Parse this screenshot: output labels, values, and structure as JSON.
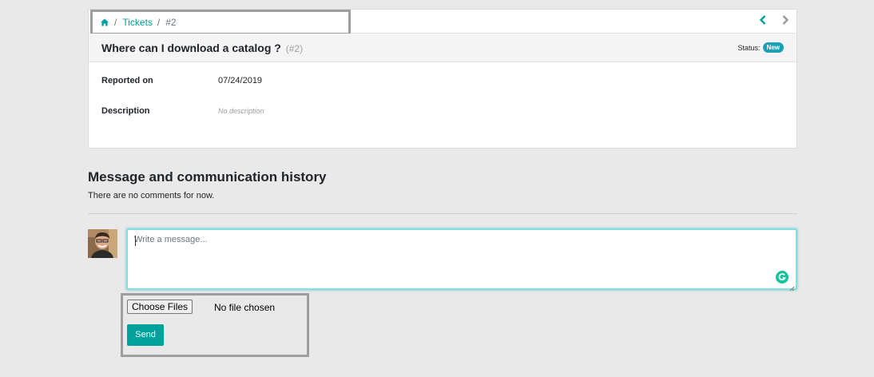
{
  "breadcrumb": {
    "home_icon": "home-icon",
    "tickets_label": "Tickets",
    "current_label": "#2",
    "separator": "/"
  },
  "nav": {
    "prev_icon": "chevron-left-icon",
    "next_icon": "chevron-right-icon"
  },
  "ticket": {
    "title": "Where can I download a catalog ?",
    "ref": "(#2)",
    "status_label": "Status:",
    "status_value": "New"
  },
  "fields": {
    "reported_label": "Reported on",
    "reported_value": "07/24/2019",
    "description_label": "Description",
    "description_value": "No description"
  },
  "history": {
    "title": "Message and communication history",
    "empty_text": "There are no comments for now."
  },
  "composer": {
    "placeholder": "Write a message...",
    "choose_files_label": "Choose Files",
    "file_status": "No file chosen",
    "send_label": "Send"
  },
  "colors": {
    "accent": "#00a09d",
    "badge": "#17a2b8",
    "background": "#e9e9e9"
  }
}
